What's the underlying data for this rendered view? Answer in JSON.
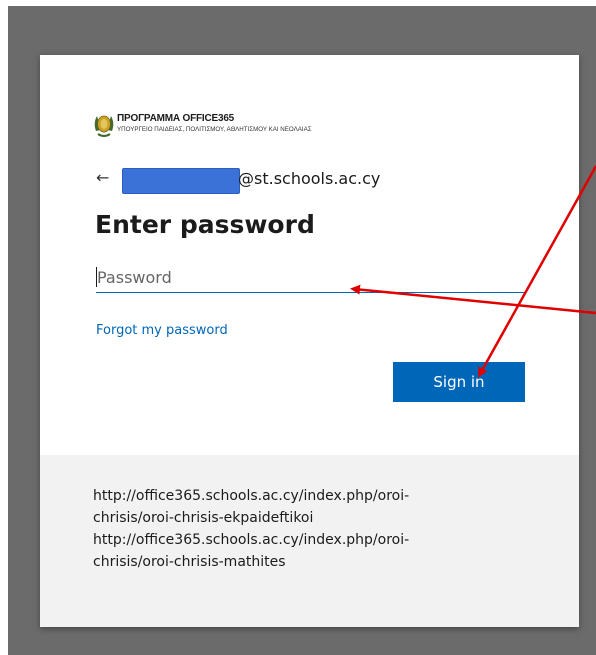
{
  "branding": {
    "title": "ΠΡΟΓΡΑΜΜΑ OFFICE365",
    "subtitle": "ΥΠΟΥΡΓΕΙΟ ΠΑΙΔΕΙΑΣ, ΠΟΛΙΤΙΣΜΟΥ, ΑΘΛΗΤΙΣΜΟΥ ΚΑΙ ΝΕΟΛΑΙΑΣ",
    "icon": "cyprus-emblem-icon"
  },
  "identity": {
    "back_icon": "back-arrow-icon",
    "back_glyph": "←",
    "email_suffix": "@st.schools.ac.cy",
    "redaction_color": "#3a72d8"
  },
  "form": {
    "heading": "Enter password",
    "password_placeholder": "Password",
    "password_value": "",
    "forgot_link": "Forgot my password",
    "signin_label": "Sign in"
  },
  "footer": {
    "lines": [
      "http://office365.schools.ac.cy/index.php/oroi-",
      "chrisis/oroi-chrisis-ekpaideftikoi",
      "http://office365.schools.ac.cy/index.php/oroi-",
      "chrisis/oroi-chrisis-mathites"
    ]
  },
  "colors": {
    "accent": "#0067b8",
    "backdrop": "#6b6b6b",
    "annotation_arrow": "#e00000",
    "footer_bg": "#f2f2f2"
  },
  "annotations": {
    "arrow_icon": "red-arrow-annotation"
  }
}
